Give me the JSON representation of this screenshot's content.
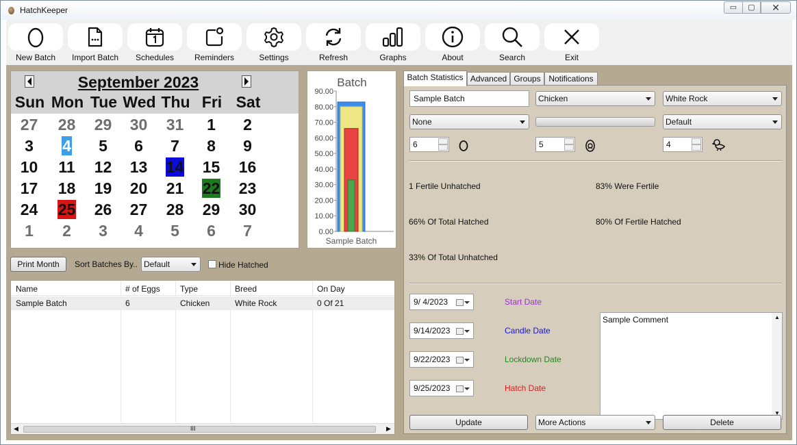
{
  "window": {
    "title": "HatchKeeper",
    "min_glyph": "▭",
    "max_glyph": "▢",
    "close_glyph": "✕"
  },
  "toolbar": [
    {
      "label": "New Batch",
      "icon": "egg-icon"
    },
    {
      "label": "Import Batch",
      "icon": "file-import-icon"
    },
    {
      "label": "Schedules",
      "icon": "calendar-icon"
    },
    {
      "label": "Reminders",
      "icon": "reminder-icon"
    },
    {
      "label": "Settings",
      "icon": "gear-icon"
    },
    {
      "label": "Refresh",
      "icon": "refresh-icon"
    },
    {
      "label": "Graphs",
      "icon": "bar-chart-icon"
    },
    {
      "label": "About",
      "icon": "info-icon"
    },
    {
      "label": "Search",
      "icon": "search-icon"
    },
    {
      "label": "Exit",
      "icon": "close-icon"
    }
  ],
  "calendar": {
    "month": "September 2023",
    "weekdays": [
      "Sun",
      "Mon",
      "Tue",
      "Wed",
      "Thu",
      "Fri",
      "Sat"
    ],
    "weeks": [
      [
        "27",
        "28",
        "29",
        "30",
        "31",
        "1",
        "2"
      ],
      [
        "3",
        "4",
        "5",
        "6",
        "7",
        "8",
        "9"
      ],
      [
        "10",
        "11",
        "12",
        "13",
        "14",
        "15",
        "16"
      ],
      [
        "17",
        "18",
        "19",
        "20",
        "21",
        "22",
        "23"
      ],
      [
        "24",
        "25",
        "26",
        "27",
        "28",
        "29",
        "30"
      ],
      [
        "1",
        "2",
        "3",
        "4",
        "5",
        "6",
        "7"
      ]
    ],
    "highlights": {
      "selected": "4",
      "candle": "14",
      "lockdown": "22",
      "hatch": "25"
    },
    "colors": {
      "selected": "#3f9ee9",
      "candle": "#0b0bdc",
      "lockdown": "#1f7a1f",
      "hatch": "#d71414"
    }
  },
  "chart_data": {
    "type": "bar",
    "title": "Batch",
    "categories": [
      "Sample Batch"
    ],
    "ylim": [
      0,
      90
    ],
    "yticks": [
      "0.00",
      "10.00",
      "20.00",
      "30.00",
      "40.00",
      "50.00",
      "60.00",
      "70.00",
      "80.00",
      "90.00"
    ],
    "bars": [
      {
        "value": 83,
        "color": "#3d8ee8"
      },
      {
        "value": 80,
        "color": "#ece784"
      },
      {
        "value": 66,
        "color": "#e84444"
      },
      {
        "value": 33,
        "color": "#4da84d"
      }
    ]
  },
  "controls": {
    "print_label": "Print Month",
    "sort_label": "Sort Batches By..",
    "sort_value": "Default",
    "hide_label": "Hide Hatched"
  },
  "table": {
    "columns": [
      "Name",
      "# of Eggs",
      "Type",
      "Breed",
      "On Day"
    ],
    "rows": [
      [
        "Sample Batch",
        "6",
        "Chicken",
        "White Rock",
        "0 Of 21"
      ]
    ],
    "scroll_glyph": "III"
  },
  "tabs": [
    "Batch Statistics",
    "Advanced",
    "Groups",
    "Notifications"
  ],
  "form": {
    "name": "Sample Batch",
    "type": "Chicken",
    "breed": "White Rock",
    "group": "None",
    "profile": "Default",
    "eggs": "6",
    "fertile": "5",
    "hatched": "4"
  },
  "stats": {
    "s1": "1 Fertile Unhatched",
    "s2": "83% Were Fertile",
    "s3": "66% Of Total Hatched",
    "s4": "80% Of Fertile Hatched",
    "s5": "33% Of Total Unhatched"
  },
  "dates": [
    {
      "value": "9/  4/2023",
      "label": "Start Date",
      "color": "#9b30d9"
    },
    {
      "value": "9/14/2023",
      "label": "Candle Date",
      "color": "#1515e0"
    },
    {
      "value": "9/22/2023",
      "label": "Lockdown Date",
      "color": "#1f8a1f"
    },
    {
      "value": "9/25/2023",
      "label": "Hatch Date",
      "color": "#e01a1a"
    }
  ],
  "comment": "Sample Comment",
  "actions": {
    "update": "Update",
    "more": "More Actions",
    "delete": "Delete"
  }
}
